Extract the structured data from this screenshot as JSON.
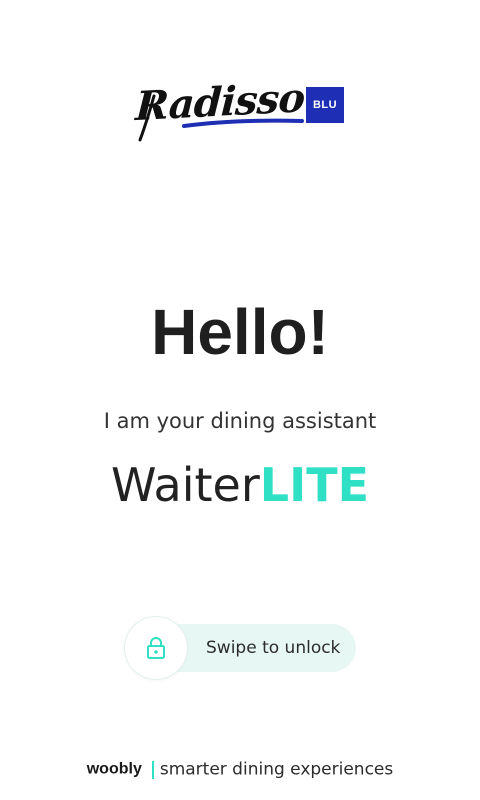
{
  "logo": {
    "wordmark": "Radisson",
    "badge": "BLU",
    "badge_color": "#1f2fb5"
  },
  "greeting": {
    "title": "Hello!",
    "subtitle": "I am your dining assistant"
  },
  "brand": {
    "part1": "Waiter",
    "part2": "LITE",
    "accent_color": "#2fe0c5"
  },
  "unlock": {
    "label": "Swipe to unlock",
    "icon": "lock-icon",
    "track_color": "#e7f8f4"
  },
  "footer": {
    "brand": "woobly",
    "tagline": "smarter dining experiences"
  }
}
